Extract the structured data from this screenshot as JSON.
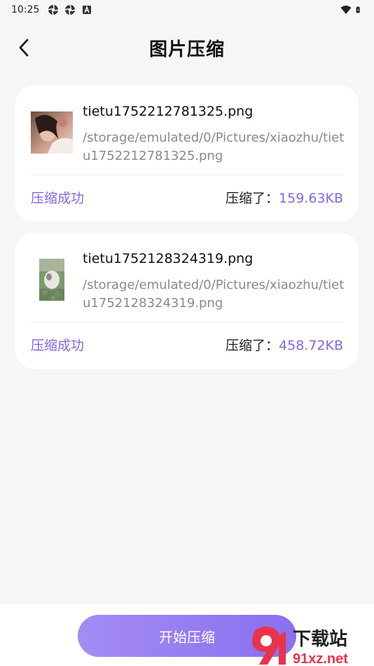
{
  "status_bar": {
    "time": "10:25",
    "left_icons": [
      "aperture-icon",
      "aperture-icon",
      "a-letter-icon"
    ],
    "right_icons": [
      "wifi-icon",
      "battery-icon"
    ]
  },
  "header": {
    "title": "图片压缩",
    "back_icon": "chevron-left-icon"
  },
  "files": [
    {
      "name": "tietu1752212781325.png",
      "path": "/storage/emulated/0/Pictures/xiaozhu/tietu1752212781325.png",
      "status": "压缩成功",
      "saved_label": "压缩了：",
      "saved_size": "159.63KB"
    },
    {
      "name": "tietu1752128324319.png",
      "path": "/storage/emulated/0/Pictures/xiaozhu/tietu1752128324319.png",
      "status": "压缩成功",
      "saved_label": "压缩了：",
      "saved_size": "458.72KB"
    }
  ],
  "bottom": {
    "start_label": "开始压缩"
  },
  "watermark": {
    "text": "下载站",
    "domain": "91xz.net"
  },
  "colors": {
    "accent": "#8367e6",
    "background": "#f6f6f6",
    "card": "#ffffff",
    "button_gradient_start": "#a48cf3",
    "button_gradient_end": "#8a6ff0"
  }
}
